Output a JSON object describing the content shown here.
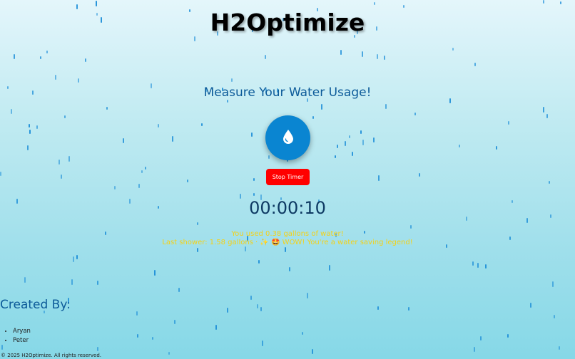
{
  "header": {
    "title": "H2Optimize"
  },
  "main": {
    "subtitle": "Measure Your Water Usage!",
    "drop_button_icon": "water-drop-icon",
    "stop_button_label": "Stop Timer",
    "timer": "00:00:10",
    "usage_line1": "You used 0.38 gallons of water!",
    "usage_line2": "Last shower: 1.58 gallons · ✨ 🤩 WOW! You're a water saving legend!"
  },
  "credits": {
    "heading": "Created By:",
    "creators": [
      "Aryan",
      "Peter"
    ]
  },
  "footer": {
    "text": "© 2025 H2Optimize. All rights reserved."
  },
  "colors": {
    "accent": "#0a85d1",
    "stop": "#ff0000",
    "usage_text": "#f4d117",
    "heading_blue": "#0c5a99",
    "rain": "#1f8fd8"
  }
}
